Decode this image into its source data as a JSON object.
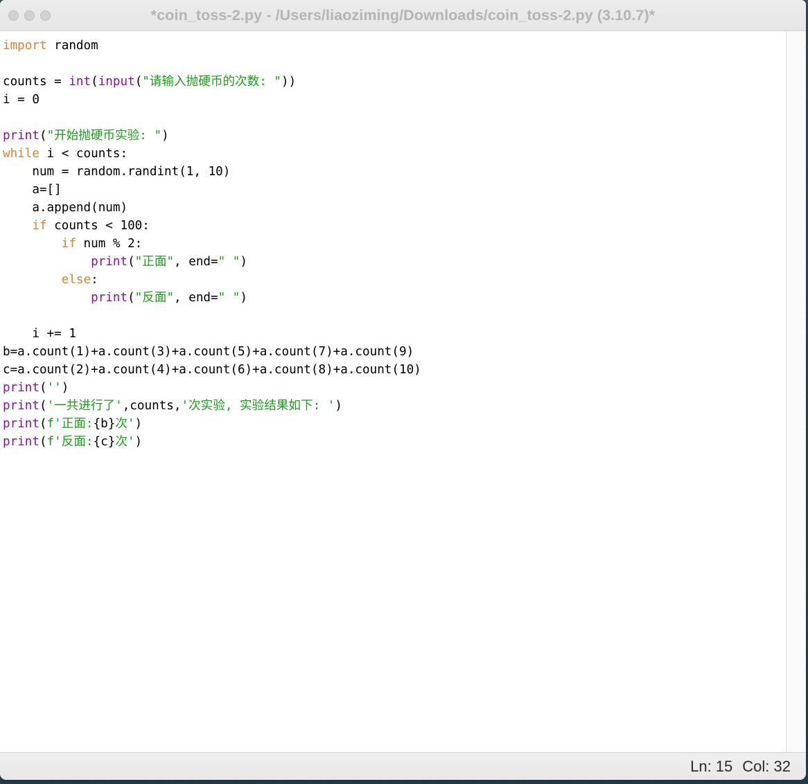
{
  "window": {
    "title": "*coin_toss-2.py - /Users/liaoziming/Downloads/coin_toss-2.py (3.10.7)*",
    "traffic_lights": [
      {
        "name": "close",
        "color": "#d2d2d2"
      },
      {
        "name": "minimize",
        "color": "#d2d2d2"
      },
      {
        "name": "zoom",
        "color": "#d2d2d2"
      }
    ]
  },
  "colors": {
    "keyword": "#e4802b",
    "builtin": "#8e0f9e",
    "string": "#18a018",
    "plain": "#000000",
    "titlebar_bg": "#ececec",
    "title_text": "#b4b4b4",
    "statusbar_bg": "#ececec",
    "editor_bg": "#ffffff",
    "desktop_bg": "#2f4e59"
  },
  "editor": {
    "language": "python",
    "filename": "coin_toss-2.py",
    "modified": true,
    "lines": [
      {
        "n": 1,
        "text": "import random"
      },
      {
        "n": 2,
        "text": ""
      },
      {
        "n": 3,
        "text": "counts = int(input(\"请输入抛硬币的次数: \"))"
      },
      {
        "n": 4,
        "text": "i = 0"
      },
      {
        "n": 5,
        "text": ""
      },
      {
        "n": 6,
        "text": "print(\"开始抛硬币实验: \")"
      },
      {
        "n": 7,
        "text": "while i < counts:"
      },
      {
        "n": 8,
        "text": "    num = random.randint(1, 10)"
      },
      {
        "n": 9,
        "text": "    a=[]"
      },
      {
        "n": 10,
        "text": "    a.append(num)"
      },
      {
        "n": 11,
        "text": "    if counts < 100:"
      },
      {
        "n": 12,
        "text": "        if num % 2:"
      },
      {
        "n": 13,
        "text": "            print(\"正面\", end=\" \")"
      },
      {
        "n": 14,
        "text": "        else:"
      },
      {
        "n": 15,
        "text": "            print(\"反面\", end=\" \")"
      },
      {
        "n": 16,
        "text": ""
      },
      {
        "n": 17,
        "text": "    i += 1"
      },
      {
        "n": 18,
        "text": "b=a.count(1)+a.count(3)+a.count(5)+a.count(7)+a.count(9)"
      },
      {
        "n": 19,
        "text": "c=a.count(2)+a.count(4)+a.count(6)+a.count(8)+a.count(10)"
      },
      {
        "n": 20,
        "text": "print('')"
      },
      {
        "n": 21,
        "text": "print('一共进行了',counts,'次实验, 实验结果如下: ')"
      },
      {
        "n": 22,
        "text": "print(f'正面:{b}次')"
      },
      {
        "n": 23,
        "text": "print(f'反面:{c}次')"
      }
    ]
  },
  "statusbar": {
    "line_label": "Ln: 15",
    "col_label": "Col: 32"
  }
}
